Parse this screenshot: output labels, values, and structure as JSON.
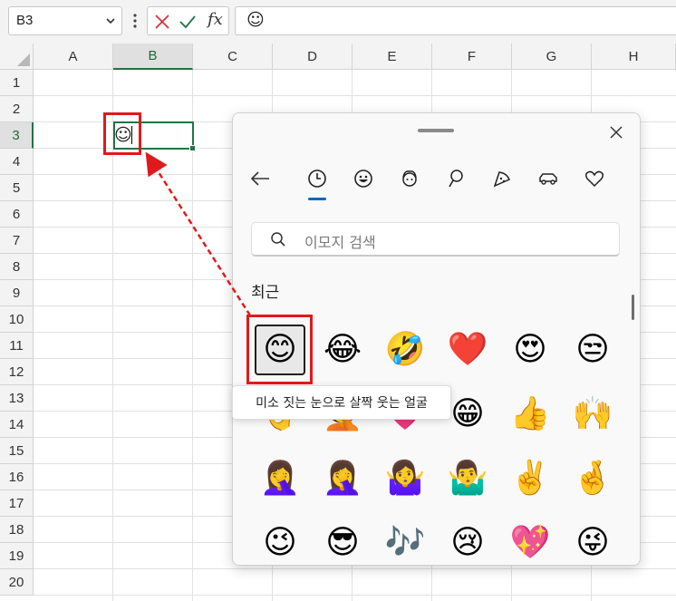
{
  "name_box": {
    "value": "B3"
  },
  "formula_bar": {
    "value": "☺"
  },
  "columns": [
    "A",
    "B",
    "C",
    "D",
    "E",
    "F",
    "G",
    "H"
  ],
  "rows": [
    "1",
    "2",
    "3",
    "4",
    "5",
    "6",
    "7",
    "8",
    "9",
    "10",
    "11",
    "12",
    "13",
    "14",
    "15",
    "16",
    "17",
    "18",
    "19",
    "20"
  ],
  "selected": {
    "column": "B",
    "row": "3"
  },
  "cell_b3": {
    "value": "☺"
  },
  "emoji_panel": {
    "search_placeholder": "이모지 검색",
    "section_title": "최근",
    "tooltip": "미소 짓는 눈으로 살짝 웃는 얼굴",
    "emojis": [
      "😊",
      "😂",
      "🤣",
      "❤️",
      "😍",
      "😒",
      "👌",
      "🤦",
      "💗",
      "😁",
      "👍",
      "🙌",
      "🤦‍♀️",
      "🤦‍♀️",
      "🤷‍♀️",
      "🤷‍♂️",
      "✌️",
      "🤞",
      "😉",
      "😎",
      "🎶",
      "😢",
      "💖",
      "😜"
    ]
  },
  "colors": {
    "excel_green": "#217346",
    "accent_blue": "#0067c0",
    "highlight_red": "#e01a1a"
  }
}
